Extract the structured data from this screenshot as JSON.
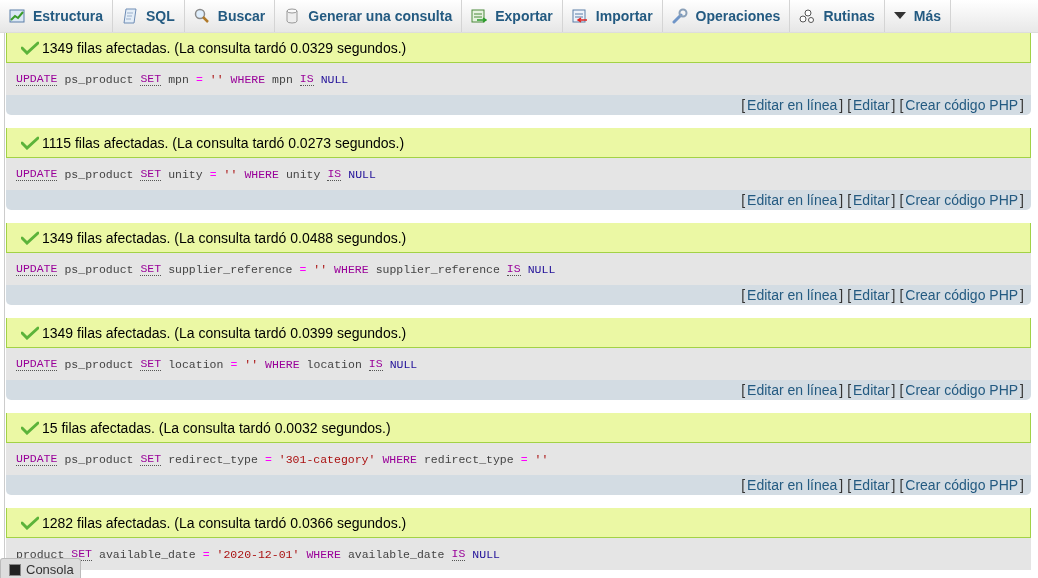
{
  "tabs": [
    {
      "label": "Estructura",
      "kind": "structure",
      "selected": false
    },
    {
      "label": "SQL",
      "kind": "scroll",
      "selected": false
    },
    {
      "label": "Buscar",
      "kind": "search",
      "selected": false
    },
    {
      "label": "Generar una consulta",
      "kind": "database",
      "selected": false
    },
    {
      "label": "Exportar",
      "kind": "export",
      "selected": false
    },
    {
      "label": "Importar",
      "kind": "import",
      "selected": false
    },
    {
      "label": "Operaciones",
      "kind": "wrench",
      "selected": false
    },
    {
      "label": "Rutinas",
      "kind": "gears",
      "selected": false
    },
    {
      "label": "Más",
      "kind": "caret",
      "selected": false
    }
  ],
  "results": [
    {
      "message": "1349 filas afectadas. (La consulta tardó 0.0329 segundos.)",
      "query": [
        {
          "kind": "doc-keyword",
          "text": "UPDATE"
        },
        {
          "kind": "name",
          "text": "ps_product"
        },
        {
          "kind": "doc-keyword",
          "text": "SET"
        },
        {
          "kind": "name",
          "text": "mpn"
        },
        {
          "kind": "operator",
          "text": "="
        },
        {
          "kind": "string",
          "text": "''"
        },
        {
          "kind": "keyword",
          "text": "WHERE"
        },
        {
          "kind": "name",
          "text": "mpn"
        },
        {
          "kind": "doc-keyword",
          "text": "IS"
        },
        {
          "kind": "literal",
          "text": "NULL"
        }
      ],
      "tools": [
        {
          "kind": "text",
          "text": "["
        },
        {
          "kind": "link",
          "text": "Editar en línea"
        },
        {
          "kind": "text",
          "text": "] ["
        },
        {
          "kind": "link",
          "text": "Editar"
        },
        {
          "kind": "text",
          "text": "] ["
        },
        {
          "kind": "link",
          "text": "Crear código PHP"
        },
        {
          "kind": "text",
          "text": "]"
        }
      ]
    },
    {
      "message": "1115 filas afectadas. (La consulta tardó 0.0273 segundos.)",
      "query": [
        {
          "kind": "doc-keyword",
          "text": "UPDATE"
        },
        {
          "kind": "name",
          "text": "ps_product"
        },
        {
          "kind": "doc-keyword",
          "text": "SET"
        },
        {
          "kind": "name",
          "text": "unity"
        },
        {
          "kind": "operator",
          "text": "="
        },
        {
          "kind": "string",
          "text": "''"
        },
        {
          "kind": "keyword",
          "text": "WHERE"
        },
        {
          "kind": "name",
          "text": "unity"
        },
        {
          "kind": "doc-keyword",
          "text": "IS"
        },
        {
          "kind": "literal",
          "text": "NULL"
        }
      ],
      "tools": [
        {
          "kind": "text",
          "text": "["
        },
        {
          "kind": "link",
          "text": "Editar en línea"
        },
        {
          "kind": "text",
          "text": "] ["
        },
        {
          "kind": "link",
          "text": "Editar"
        },
        {
          "kind": "text",
          "text": "] ["
        },
        {
          "kind": "link",
          "text": "Crear código PHP"
        },
        {
          "kind": "text",
          "text": "]"
        }
      ]
    },
    {
      "message": "1349 filas afectadas. (La consulta tardó 0.0488 segundos.)",
      "query": [
        {
          "kind": "doc-keyword",
          "text": "UPDATE"
        },
        {
          "kind": "name",
          "text": "ps_product"
        },
        {
          "kind": "doc-keyword",
          "text": "SET"
        },
        {
          "kind": "name",
          "text": "supplier_reference"
        },
        {
          "kind": "operator",
          "text": "="
        },
        {
          "kind": "string",
          "text": "''"
        },
        {
          "kind": "keyword",
          "text": "WHERE"
        },
        {
          "kind": "name",
          "text": "supplier_reference"
        },
        {
          "kind": "doc-keyword",
          "text": "IS"
        },
        {
          "kind": "literal",
          "text": "NULL"
        }
      ],
      "tools": [
        {
          "kind": "text",
          "text": "["
        },
        {
          "kind": "link",
          "text": "Editar en línea"
        },
        {
          "kind": "text",
          "text": "] ["
        },
        {
          "kind": "link",
          "text": "Editar"
        },
        {
          "kind": "text",
          "text": "] ["
        },
        {
          "kind": "link",
          "text": "Crear código PHP"
        },
        {
          "kind": "text",
          "text": "]"
        }
      ]
    },
    {
      "message": "1349 filas afectadas. (La consulta tardó 0.0399 segundos.)",
      "query": [
        {
          "kind": "doc-keyword",
          "text": "UPDATE"
        },
        {
          "kind": "name",
          "text": "ps_product"
        },
        {
          "kind": "doc-keyword",
          "text": "SET"
        },
        {
          "kind": "name",
          "text": "location"
        },
        {
          "kind": "operator",
          "text": "="
        },
        {
          "kind": "string",
          "text": "''"
        },
        {
          "kind": "keyword",
          "text": "WHERE"
        },
        {
          "kind": "name",
          "text": "location"
        },
        {
          "kind": "doc-keyword",
          "text": "IS"
        },
        {
          "kind": "literal",
          "text": "NULL"
        }
      ],
      "tools": [
        {
          "kind": "text",
          "text": "["
        },
        {
          "kind": "link",
          "text": "Editar en línea"
        },
        {
          "kind": "text",
          "text": "] ["
        },
        {
          "kind": "link",
          "text": "Editar"
        },
        {
          "kind": "text",
          "text": "] ["
        },
        {
          "kind": "link",
          "text": "Crear código PHP"
        },
        {
          "kind": "text",
          "text": "]"
        }
      ]
    },
    {
      "message": "15 filas afectadas. (La consulta tardó 0.0032 segundos.)",
      "query": [
        {
          "kind": "doc-keyword",
          "text": "UPDATE"
        },
        {
          "kind": "name",
          "text": "ps_product"
        },
        {
          "kind": "doc-keyword",
          "text": "SET"
        },
        {
          "kind": "name",
          "text": "redirect_type"
        },
        {
          "kind": "operator",
          "text": "="
        },
        {
          "kind": "string",
          "text": "'301-category'"
        },
        {
          "kind": "keyword",
          "text": "WHERE"
        },
        {
          "kind": "name",
          "text": "redirect_type"
        },
        {
          "kind": "operator",
          "text": "="
        },
        {
          "kind": "string",
          "text": "''"
        }
      ],
      "tools": [
        {
          "kind": "text",
          "text": "["
        },
        {
          "kind": "link",
          "text": "Editar en línea"
        },
        {
          "kind": "text",
          "text": "] ["
        },
        {
          "kind": "link",
          "text": "Editar"
        },
        {
          "kind": "text",
          "text": "] ["
        },
        {
          "kind": "link",
          "text": "Crear código PHP"
        },
        {
          "kind": "text",
          "text": "]"
        }
      ]
    },
    {
      "message": "1282 filas afectadas. (La consulta tardó 0.0366 segundos.)",
      "query": [
        {
          "kind": "name",
          "text": "product"
        },
        {
          "kind": "doc-keyword",
          "text": "SET"
        },
        {
          "kind": "name",
          "text": "available_date"
        },
        {
          "kind": "operator",
          "text": "="
        },
        {
          "kind": "string",
          "text": "'2020-12-01'"
        },
        {
          "kind": "keyword",
          "text": "WHERE"
        },
        {
          "kind": "name",
          "text": "available_date"
        },
        {
          "kind": "doc-keyword",
          "text": "IS"
        },
        {
          "kind": "literal",
          "text": "NULL"
        }
      ]
    }
  ],
  "console": {
    "label": "Consola"
  }
}
